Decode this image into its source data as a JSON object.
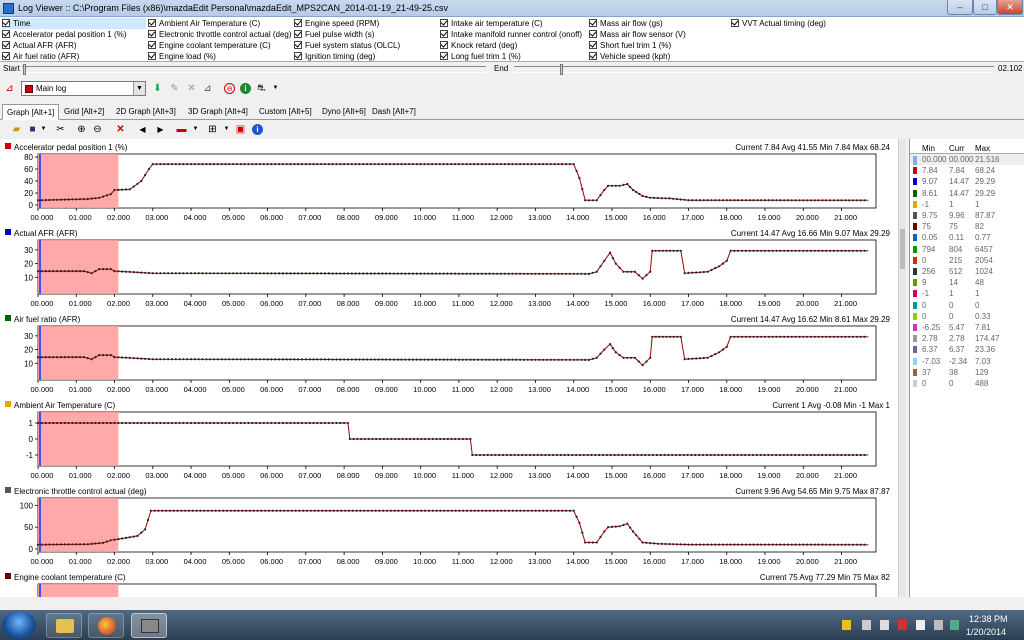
{
  "window": {
    "title": "Log Viewer :: C:\\Program Files (x86)\\mazdaEdit Personal\\mazdaEdit_MPS2CAN_2014-01-19_21-49-25.csv",
    "minimize": "–",
    "maximize": "□",
    "close": "✕"
  },
  "channels": [
    {
      "label": "Time",
      "col": 0,
      "row": 0
    },
    {
      "label": "Accelerator pedal position 1 (%)",
      "col": 0,
      "row": 1
    },
    {
      "label": "Actual AFR (AFR)",
      "col": 0,
      "row": 2
    },
    {
      "label": "Air fuel ratio (AFR)",
      "col": 0,
      "row": 3
    },
    {
      "label": "Ambient Air Temperature (C)",
      "col": 1,
      "row": 0
    },
    {
      "label": "Electronic throttle control actual (deg)",
      "col": 1,
      "row": 1
    },
    {
      "label": "Engine coolant temperature (C)",
      "col": 1,
      "row": 2
    },
    {
      "label": "Engine load (%)",
      "col": 1,
      "row": 3
    },
    {
      "label": "Engine speed (RPM)",
      "col": 2,
      "row": 0
    },
    {
      "label": "Fuel pulse width (s)",
      "col": 2,
      "row": 1
    },
    {
      "label": "Fuel system status (OLCL)",
      "col": 2,
      "row": 2
    },
    {
      "label": "Ignition timing (deg)",
      "col": 2,
      "row": 3
    },
    {
      "label": "Intake air temperature (C)",
      "col": 3,
      "row": 0
    },
    {
      "label": "Intake manifold runner control (onoff)",
      "col": 3,
      "row": 1
    },
    {
      "label": "Knock retard (deg)",
      "col": 3,
      "row": 2
    },
    {
      "label": "Long fuel trim 1 (%)",
      "col": 3,
      "row": 3
    },
    {
      "label": "Mass air flow (gs)",
      "col": 4,
      "row": 0
    },
    {
      "label": "Mass air flow sensor (V)",
      "col": 4,
      "row": 1
    },
    {
      "label": "Short fuel trim 1 (%)",
      "col": 4,
      "row": 2
    },
    {
      "label": "Vehicle speed (kph)",
      "col": 4,
      "row": 3
    },
    {
      "label": "VVT Actual timing (deg)",
      "col": 5,
      "row": 0
    }
  ],
  "range": {
    "start_label": "Start",
    "end_label": "End",
    "end_value": "02.102"
  },
  "log_select": {
    "value": "Main log"
  },
  "tabs": [
    "Graph [Alt+1]",
    "Grid [Alt+2]",
    "2D Graph [Alt+3]",
    "3D Graph [Alt+4]",
    "Custom [Alt+5]",
    "Dyno [Alt+6]",
    "Dash [Alt+7]"
  ],
  "x_ticks": [
    "00.000",
    "01.000",
    "02.000",
    "03.000",
    "04.000",
    "05.000",
    "06.000",
    "07.000",
    "08.000",
    "09.000",
    "10.000",
    "11.000",
    "12.000",
    "13.000",
    "14.000",
    "15.000",
    "16.000",
    "17.000",
    "18.000",
    "19.000",
    "20.000",
    "21.000"
  ],
  "graphs": [
    {
      "title": "Accelerator pedal position 1 (%)",
      "stats": "Current 7.84 Avg 41.55 Min 7.84 Max 68.24",
      "color": "#cc0000",
      "ylim": [
        0,
        80
      ],
      "yticks": [
        "80",
        "60",
        "40",
        "20",
        "0"
      ],
      "points": [
        [
          0,
          7.84
        ],
        [
          1.3,
          10
        ],
        [
          1.6,
          12
        ],
        [
          1.9,
          18
        ],
        [
          2.0,
          25
        ],
        [
          2.4,
          26
        ],
        [
          2.7,
          40
        ],
        [
          2.9,
          60
        ],
        [
          3.0,
          68.24
        ],
        [
          14.0,
          68.24
        ],
        [
          14.15,
          45
        ],
        [
          14.3,
          7.84
        ],
        [
          14.6,
          7.84
        ],
        [
          14.8,
          25
        ],
        [
          14.9,
          32
        ],
        [
          15.2,
          32
        ],
        [
          15.4,
          35
        ],
        [
          15.55,
          25
        ],
        [
          15.8,
          15
        ],
        [
          16.0,
          12
        ],
        [
          16.5,
          11
        ],
        [
          17.0,
          8
        ],
        [
          21.7,
          7.84
        ]
      ]
    },
    {
      "title": "Actual AFR (AFR)",
      "stats": "Current 14.47 Avg 16.66 Min 9.07 Max 29.29",
      "color": "#0000cc",
      "ylim": [
        0,
        35
      ],
      "yticks": [
        "30",
        "20",
        "10"
      ],
      "points": [
        [
          0,
          14.47
        ],
        [
          1.2,
          14.5
        ],
        [
          1.4,
          13
        ],
        [
          1.6,
          16
        ],
        [
          1.9,
          16
        ],
        [
          2.0,
          14.5
        ],
        [
          3.0,
          13
        ],
        [
          14.4,
          12.5
        ],
        [
          14.6,
          14
        ],
        [
          14.8,
          22
        ],
        [
          14.95,
          28
        ],
        [
          15.1,
          20
        ],
        [
          15.3,
          14
        ],
        [
          15.6,
          14
        ],
        [
          15.8,
          9.07
        ],
        [
          16.0,
          14
        ],
        [
          16.05,
          29.29
        ],
        [
          16.8,
          29.29
        ],
        [
          16.9,
          13
        ],
        [
          17.5,
          14
        ],
        [
          17.8,
          18
        ],
        [
          18.0,
          22
        ],
        [
          18.1,
          29.29
        ],
        [
          21.7,
          29.29
        ]
      ]
    },
    {
      "title": "Air fuel ratio (AFR)",
      "stats": "Current 14.47 Avg 16.62 Min 8.61 Max 29.29",
      "color": "#006600",
      "ylim": [
        0,
        35
      ],
      "yticks": [
        "30",
        "20",
        "10"
      ],
      "points": [
        [
          0,
          14.47
        ],
        [
          1.2,
          14.5
        ],
        [
          1.4,
          13
        ],
        [
          1.6,
          16
        ],
        [
          1.9,
          16
        ],
        [
          2.0,
          14.5
        ],
        [
          3.0,
          13
        ],
        [
          14.4,
          12.5
        ],
        [
          14.6,
          14
        ],
        [
          14.8,
          20
        ],
        [
          14.95,
          24
        ],
        [
          15.1,
          18
        ],
        [
          15.3,
          14
        ],
        [
          15.6,
          14
        ],
        [
          15.8,
          8.61
        ],
        [
          16.0,
          14
        ],
        [
          16.05,
          29.29
        ],
        [
          16.8,
          29.29
        ],
        [
          16.9,
          13
        ],
        [
          17.5,
          14
        ],
        [
          17.8,
          18
        ],
        [
          18.0,
          22
        ],
        [
          18.1,
          29.29
        ],
        [
          21.7,
          29.29
        ]
      ]
    },
    {
      "title": "Ambient Air Temperature (C)",
      "stats": "Current 1 Avg -0.08 Min -1 Max 1",
      "color": "#e6a800",
      "ylim": [
        -1.5,
        1.5
      ],
      "yticks": [
        "1",
        "0",
        "-1"
      ],
      "points": [
        [
          0,
          1
        ],
        [
          8.1,
          1
        ],
        [
          8.15,
          0
        ],
        [
          11.3,
          0
        ],
        [
          11.35,
          -1
        ],
        [
          21.7,
          -1
        ]
      ]
    },
    {
      "title": "Electronic throttle control actual (deg)",
      "stats": "Current 9.96 Avg 54.65 Min 9.75 Max 87.87",
      "color": "#555555",
      "ylim": [
        0,
        110
      ],
      "yticks": [
        "100",
        "50",
        "0"
      ],
      "points": [
        [
          0,
          9.96
        ],
        [
          1.3,
          11
        ],
        [
          1.7,
          14
        ],
        [
          1.9,
          20
        ],
        [
          2.2,
          24
        ],
        [
          2.6,
          30
        ],
        [
          2.8,
          45
        ],
        [
          2.95,
          87.87
        ],
        [
          14.0,
          87.87
        ],
        [
          14.15,
          60
        ],
        [
          14.3,
          15
        ],
        [
          14.6,
          15
        ],
        [
          14.8,
          40
        ],
        [
          14.9,
          50
        ],
        [
          15.2,
          52
        ],
        [
          15.4,
          58
        ],
        [
          15.55,
          40
        ],
        [
          15.8,
          15
        ],
        [
          16.2,
          12
        ],
        [
          17.0,
          10
        ],
        [
          21.7,
          9.96
        ]
      ]
    },
    {
      "title": "Engine coolant temperature (C)",
      "stats": "Current 75 Avg 77.29 Min 75 Max 82",
      "color": "#660000",
      "ylim": [
        70,
        90
      ],
      "yticks": [],
      "points": [
        [
          20.1,
          80
        ],
        [
          21.7,
          80
        ]
      ]
    }
  ],
  "selection": {
    "from": 0,
    "to": 2.1
  },
  "summary": {
    "headers": [
      "Min",
      "Curr",
      "Max"
    ],
    "rows": [
      {
        "color": "#7fb3e6",
        "min": "00.000",
        "curr": "00.000",
        "max": "21.516",
        "selected": true
      },
      {
        "color": "#cc0000",
        "min": "7.84",
        "curr": "7.84",
        "max": "68.24"
      },
      {
        "color": "#0000cc",
        "min": "9.07",
        "curr": "14.47",
        "max": "29.29"
      },
      {
        "color": "#006600",
        "min": "8.61",
        "curr": "14.47",
        "max": "29.29"
      },
      {
        "color": "#e6a800",
        "min": "-1",
        "curr": "1",
        "max": "1"
      },
      {
        "color": "#555555",
        "min": "9.75",
        "curr": "9.96",
        "max": "87.87"
      },
      {
        "color": "#660000",
        "min": "75",
        "curr": "75",
        "max": "82"
      },
      {
        "color": "#0066cc",
        "min": "0.05",
        "curr": "0.11",
        "max": "0.77"
      },
      {
        "color": "#009900",
        "min": "794",
        "curr": "804",
        "max": "6457"
      },
      {
        "color": "#cc3300",
        "min": "0",
        "curr": "215",
        "max": "2054"
      },
      {
        "color": "#333333",
        "min": "256",
        "curr": "512",
        "max": "1024"
      },
      {
        "color": "#669900",
        "min": "9",
        "curr": "14",
        "max": "48"
      },
      {
        "color": "#cc0066",
        "min": "-1",
        "curr": "1",
        "max": "1"
      },
      {
        "color": "#009999",
        "min": "0",
        "curr": "0",
        "max": "0"
      },
      {
        "color": "#99cc00",
        "min": "0",
        "curr": "0",
        "max": "0.33"
      },
      {
        "color": "#cc33cc",
        "min": "-6.25",
        "curr": "5.47",
        "max": "7.81"
      },
      {
        "color": "#999999",
        "min": "2.78",
        "curr": "2.78",
        "max": "174.47"
      },
      {
        "color": "#666699",
        "min": "6.37",
        "curr": "6.37",
        "max": "23.36"
      },
      {
        "color": "#99ccff",
        "min": "-7.03",
        "curr": "-2.34",
        "max": "7.03"
      },
      {
        "color": "#996633",
        "min": "37",
        "curr": "38",
        "max": "129"
      },
      {
        "color": "#cccccc",
        "min": "0",
        "curr": "0",
        "max": "488"
      }
    ]
  },
  "taskbar": {
    "time": "12:38 PM",
    "date": "1/20/2014"
  }
}
